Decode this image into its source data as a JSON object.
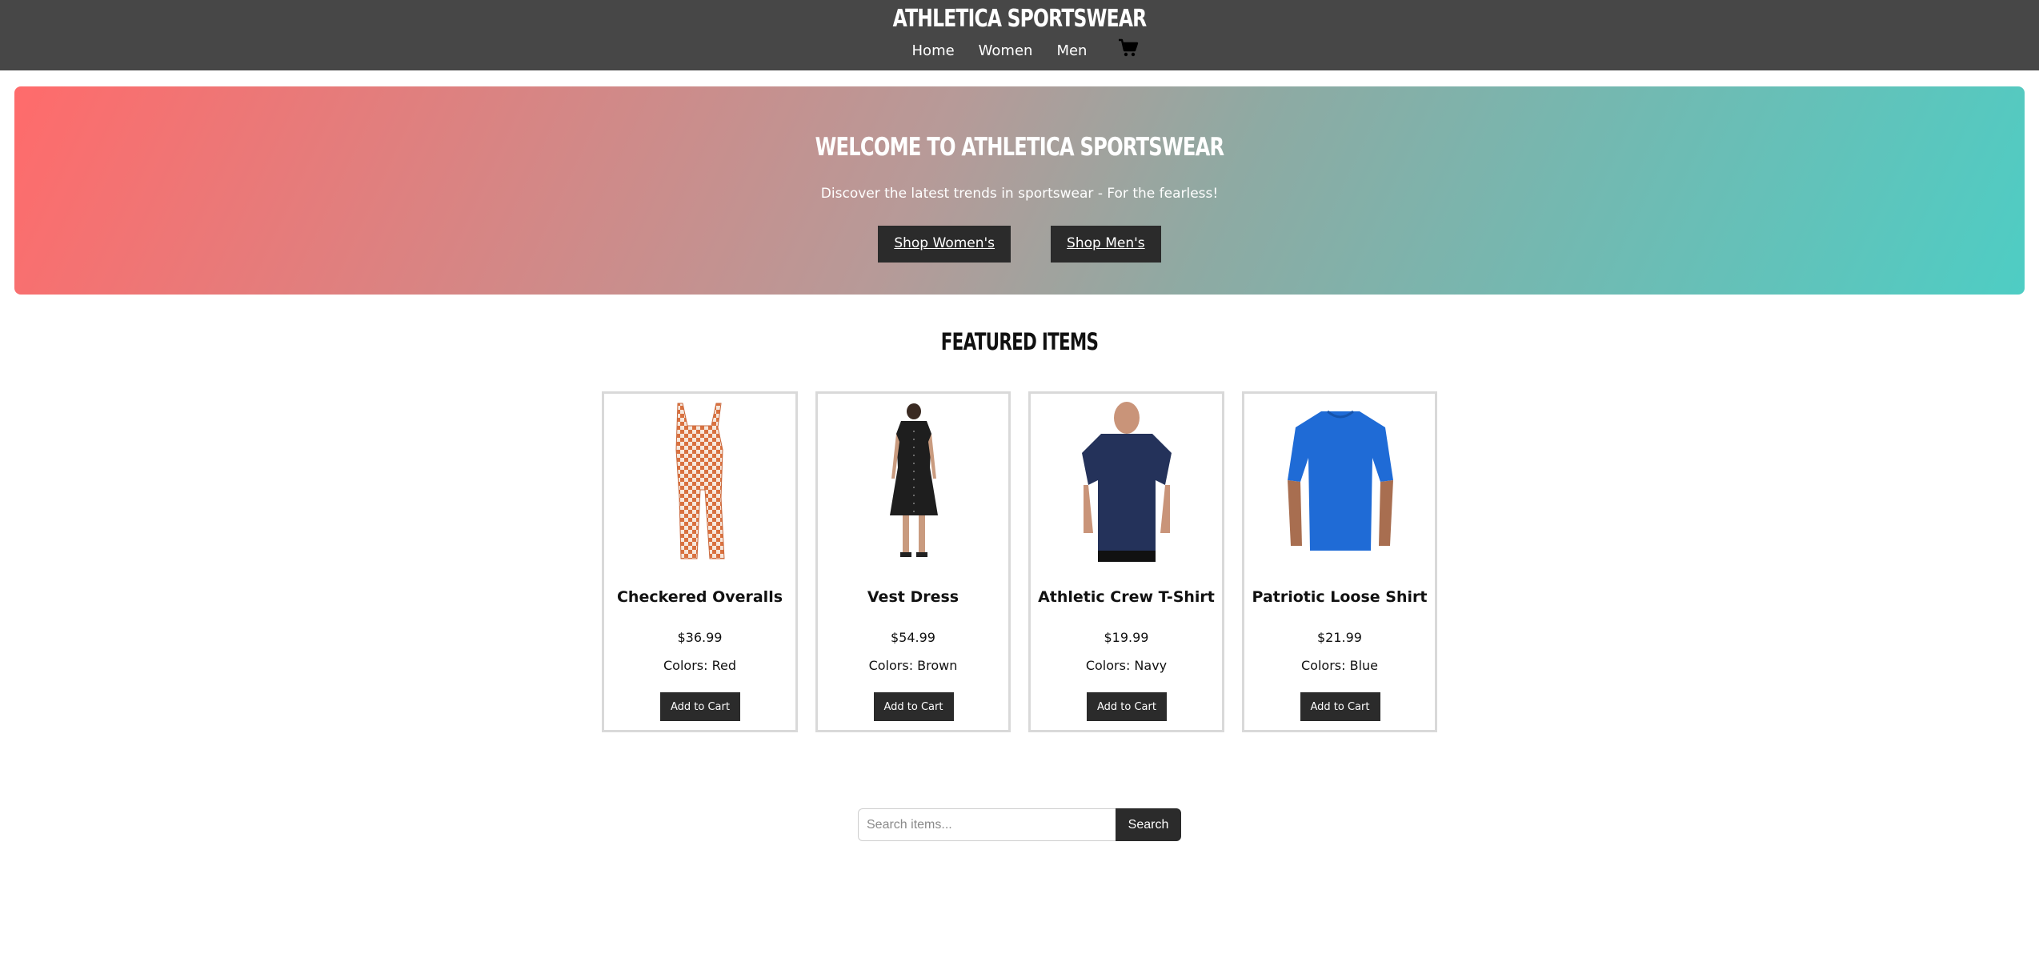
{
  "header": {
    "brand": "ATHLETICA SPORTSWEAR",
    "nav": [
      {
        "label": "Home"
      },
      {
        "label": "Women"
      },
      {
        "label": "Men"
      }
    ],
    "cart_icon": "shopping-cart-icon"
  },
  "hero": {
    "title": "WELCOME TO ATHLETICA SPORTSWEAR",
    "subtitle": "Discover the latest trends in sportswear - For the fearless!",
    "buttons": [
      {
        "label": "Shop Women's"
      },
      {
        "label": "Shop Men's"
      }
    ],
    "gradient": [
      "#ff6b6b",
      "#4ecdc4"
    ]
  },
  "featured": {
    "title": "FEATURED ITEMS",
    "products": [
      {
        "name": "Checkered Overalls",
        "price": "$36.99",
        "colors": "Colors: Red",
        "button": "Add to Cart",
        "image": "checkered-overalls-image"
      },
      {
        "name": "Vest Dress",
        "price": "$54.99",
        "colors": "Colors: Brown",
        "button": "Add to Cart",
        "image": "vest-dress-image"
      },
      {
        "name": "Athletic Crew T-Shirt",
        "price": "$19.99",
        "colors": "Colors: Navy",
        "button": "Add to Cart",
        "image": "navy-tshirt-image"
      },
      {
        "name": "Patriotic Loose Shirt",
        "price": "$21.99",
        "colors": "Colors: Blue",
        "button": "Add to Cart",
        "image": "blue-shirt-image"
      }
    ]
  },
  "search": {
    "placeholder": "Search items...",
    "value": "",
    "button": "Search"
  },
  "colors": {
    "header_bg": "#474747",
    "button_bg": "#2b2b2b",
    "card_border": "#d9d9d9"
  }
}
